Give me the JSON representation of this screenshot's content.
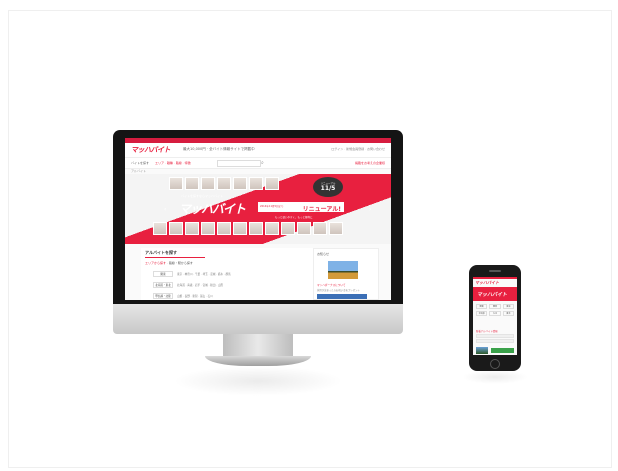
{
  "site": {
    "logo": "マッハバイト",
    "tagline": "最大10,000円 · 全バイト情報サイトで掲載中",
    "header_links": "ログイン · 新規会員登録 · お問い合わせ",
    "nav_label": "バイトを探す",
    "nav_links": "エリア · 職種 · 路線 · 特徴",
    "nav_right": "掲載をお考えの企業様",
    "breadcrumb": "アルバイト",
    "hero": {
      "small_text": "バイトを探すならマッハバイト",
      "logo": "マッハバイト",
      "banner_sub": "2014年11月5日より",
      "banner_main": "リニューアル!",
      "caption": "もっと使いやすく、もっと便利に",
      "date_sub": "リニューアル",
      "date_main": "11/5",
      "prev_arrow": "‹",
      "next_arrow": "›"
    },
    "panel": {
      "title": "アルバイトを探す",
      "tab_1": "エリアから探す",
      "tab_2": "路線・駅から探す",
      "rows": [
        {
          "label": "関東",
          "values": "東京 · 神奈川 · 千葉 · 埼玉 · 茨城 · 栃木 · 群馬"
        },
        {
          "label": "北海道・東北",
          "values": "北海道 · 青森 · 岩手 · 宮城 · 秋田 · 山形"
        },
        {
          "label": "甲信越・北陸",
          "values": "山梨 · 長野 · 新潟 · 富山 · 石川"
        }
      ]
    },
    "side": {
      "title": "お知らせ",
      "link": "マッハボーナスについて",
      "text": "採用が決まったらお祝い金をプレゼント"
    }
  },
  "mobile": {
    "logo": "マッハバイト",
    "hero_text": "マッハバイト",
    "grid": [
      "関東",
      "関西",
      "東海",
      "北海道",
      "九州",
      "東北"
    ],
    "link": "新着アルバイト情報"
  }
}
